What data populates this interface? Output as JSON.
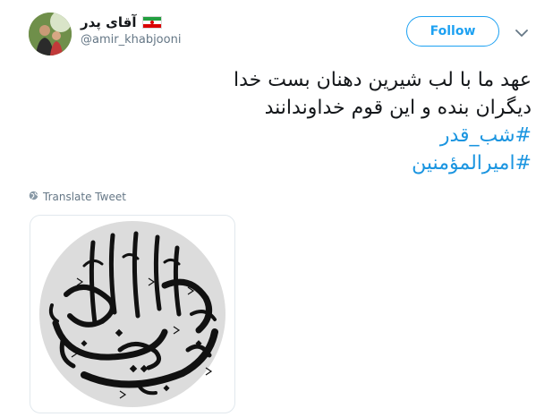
{
  "author": {
    "display_name": "آقای پدر",
    "flag_emoji": "iran-flag-icon",
    "handle": "@amir_khabjooni"
  },
  "header": {
    "follow_label": "Follow",
    "menu_icon": "chevron-down-icon"
  },
  "tweet": {
    "line1": "عهد ما با لب شیرین دهنان بست خدا",
    "line2": "دیگران بنده و این قوم خداوندانند",
    "hashtag1": "#شب_قدر",
    "hashtag2": "#امیرالمؤمنین"
  },
  "translate": {
    "label": "Translate Tweet",
    "icon": "globe-icon"
  },
  "media": {
    "description_icon": "calligraphy-image",
    "lettering": "یا علی بن ابی طالب"
  },
  "colors": {
    "accent": "#1da1f2",
    "hashtag": "#1b95e0",
    "secondary_text": "#657786",
    "border": "#e1e8ed",
    "media_circle": "#dcdcdc",
    "calligraphy": "#111111"
  }
}
